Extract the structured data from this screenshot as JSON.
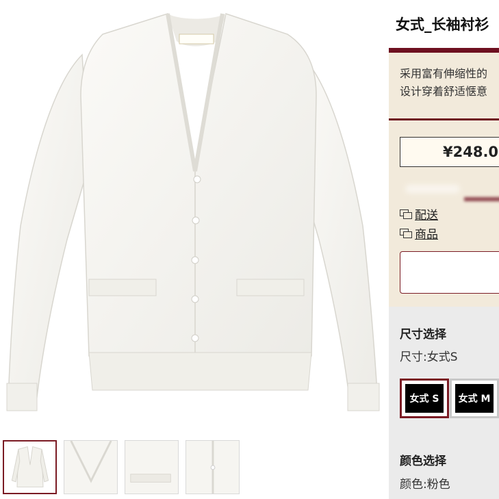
{
  "product": {
    "title": "女式_长袖衬衫",
    "description_lines": [
      "采用富有伸缩性的",
      "设计穿着舒适惬意"
    ],
    "price": "¥248.0",
    "brand_tag": "yajiansiumy"
  },
  "links": [
    {
      "label": "配送",
      "icon": "chat-icon"
    },
    {
      "label": "商品",
      "icon": "chat-icon"
    }
  ],
  "size": {
    "section_title": "尺寸选择",
    "current": "尺寸:女式S",
    "options": [
      {
        "label": "女式 S",
        "selected": true
      },
      {
        "label": "女式 M",
        "selected": false
      }
    ]
  },
  "color": {
    "section_title": "颜色选择",
    "current": "颜色:粉色"
  },
  "colors": {
    "accent": "#6e1020",
    "panel_bg": "#f2eadb",
    "selector_bg": "#ebebeb",
    "garment": "#f8f6f2"
  }
}
